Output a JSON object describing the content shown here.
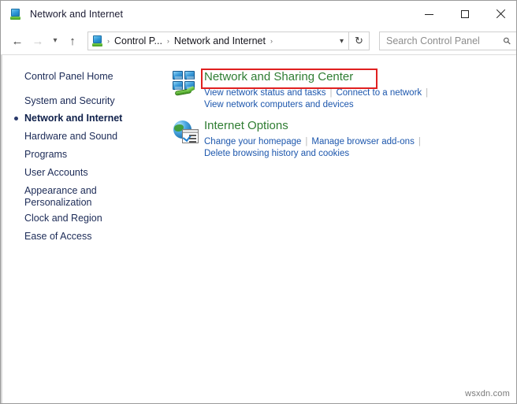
{
  "window": {
    "title": "Network and Internet",
    "title_icon": "control-panel-icon",
    "controls": {
      "minimize": "minimize-icon",
      "maximize": "maximize-icon",
      "close": "close-icon"
    }
  },
  "navbar": {
    "back": "back-arrow-icon",
    "forward": "forward-arrow-icon",
    "recent": "chevron-down-icon",
    "up": "up-arrow-icon",
    "refresh": "refresh-icon",
    "address_dropdown": "chevron-down-icon",
    "breadcrumb": {
      "icon": "control-panel-icon",
      "items": [
        "Control P...",
        "Network and Internet"
      ],
      "separator": "›"
    },
    "search": {
      "placeholder": "Search Control Panel",
      "value": "",
      "icon": "search-icon"
    }
  },
  "sidebar": {
    "items": [
      {
        "label": "Control Panel Home",
        "current": false
      },
      {
        "label": "System and Security",
        "current": false
      },
      {
        "label": "Network and Internet",
        "current": true
      },
      {
        "label": "Hardware and Sound",
        "current": false
      },
      {
        "label": "Programs",
        "current": false
      },
      {
        "label": "User Accounts",
        "current": false
      },
      {
        "label": "Appearance and Personalization",
        "current": false
      },
      {
        "label": "Clock and Region",
        "current": false
      },
      {
        "label": "Ease of Access",
        "current": false
      }
    ]
  },
  "main": {
    "categories": [
      {
        "icon": "network-sharing-center-icon",
        "title": "Network and Sharing Center",
        "title_color": "#2f7d32",
        "highlighted": true,
        "links_row1": [
          "View network status and tasks",
          "Connect to a network"
        ],
        "links_row2": [
          "View network computers and devices"
        ]
      },
      {
        "icon": "internet-options-icon",
        "title": "Internet Options",
        "title_color": "#2f7d32",
        "highlighted": false,
        "links_row1": [
          "Change your homepage",
          "Manage browser add-ons"
        ],
        "links_row2": [
          "Delete browsing history and cookies"
        ]
      }
    ]
  },
  "annotation": {
    "color": "#e02020",
    "target": "Network and Sharing Center"
  },
  "watermark": {
    "text": "wsxdn.com"
  }
}
